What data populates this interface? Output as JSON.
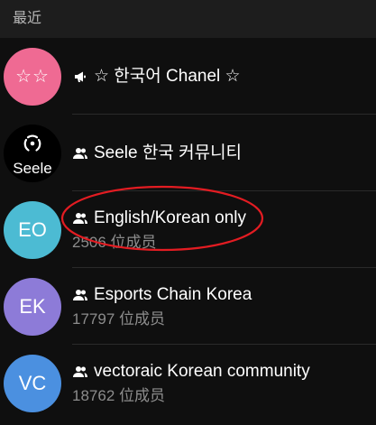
{
  "header": {
    "section_title": "最近"
  },
  "chats": [
    {
      "avatar_text": "☆☆",
      "avatar_color": "#ef6a93",
      "type_icon": "megaphone-icon",
      "title": "☆ 한국어 Chanel ☆",
      "subtitle": ""
    },
    {
      "avatar_text": "Seele",
      "avatar_color": "#000000",
      "type_icon": "group-icon",
      "title": "Seele 한국 커뮤니티",
      "subtitle": ""
    },
    {
      "avatar_text": "EO",
      "avatar_color": "#4cbbd3",
      "type_icon": "group-icon",
      "title": "English/Korean only",
      "subtitle": "2506 位成员"
    },
    {
      "avatar_text": "EK",
      "avatar_color": "#8d7bd8",
      "type_icon": "group-icon",
      "title": "Esports Chain Korea",
      "subtitle": "17797 位成员"
    },
    {
      "avatar_text": "VC",
      "avatar_color": "#4b90e0",
      "type_icon": "group-icon",
      "title": "vectoraic Korean community",
      "subtitle": "18762 位成员"
    }
  ],
  "annotation": {
    "color": "#e31c22"
  }
}
